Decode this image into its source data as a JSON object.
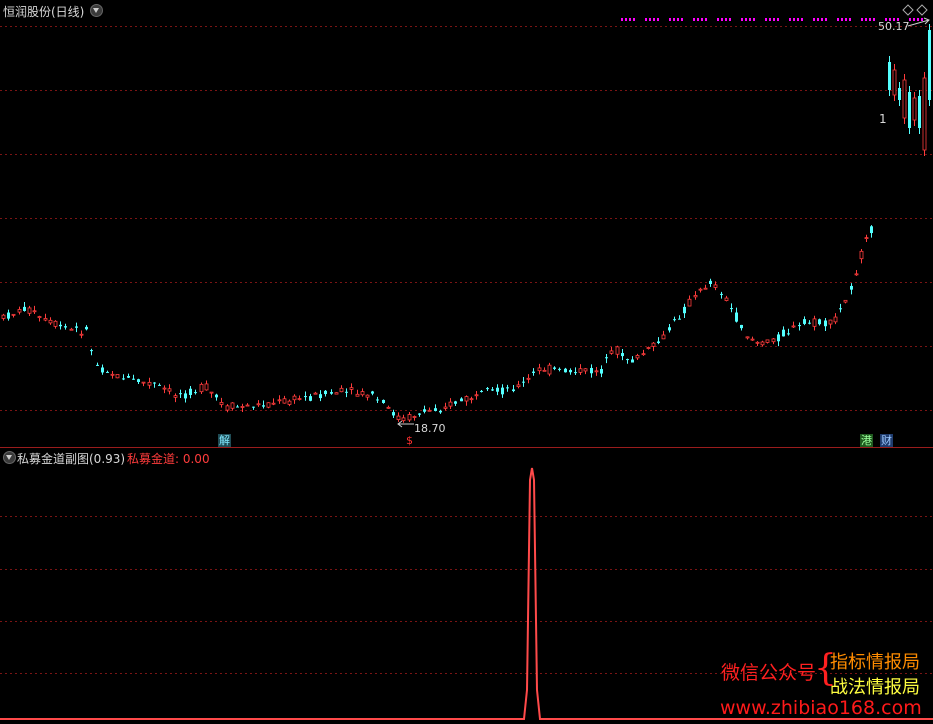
{
  "main_panel": {
    "title": "恒润股份(日线)",
    "price_high_label": "50.17",
    "price_low_label": "18.70",
    "marker_1": "1",
    "event_tags": [
      {
        "text": "解",
        "bg": "#1f4c55",
        "fg": "#7fe8ff"
      },
      {
        "text": "$",
        "bg": "transparent",
        "fg": "#ff3030"
      },
      {
        "text": "港",
        "bg": "#1f5a1f",
        "fg": "#9cff9c"
      },
      {
        "text": "财",
        "bg": "#1f3c6e",
        "fg": "#9cc8ff"
      }
    ],
    "colors": {
      "up": "#ff3c3c",
      "down": "#54ffff",
      "grid": "#7a1414",
      "dots": "#ff00ff"
    }
  },
  "sub_panel": {
    "title": "私募金道副图(0.93)",
    "indicator_label": "私募金道: 0.00",
    "colors": {
      "line": "#ff4a4a",
      "label": "#ff3c3c"
    }
  },
  "watermark": {
    "wechat": "微信公众号",
    "brace": "{",
    "line1": "指标情报局",
    "line2": "战法情报局",
    "url": "www.zhibiao168.com"
  },
  "icons": [
    "dropdown-icon",
    "diamond-icon",
    "arrow-icon"
  ]
}
